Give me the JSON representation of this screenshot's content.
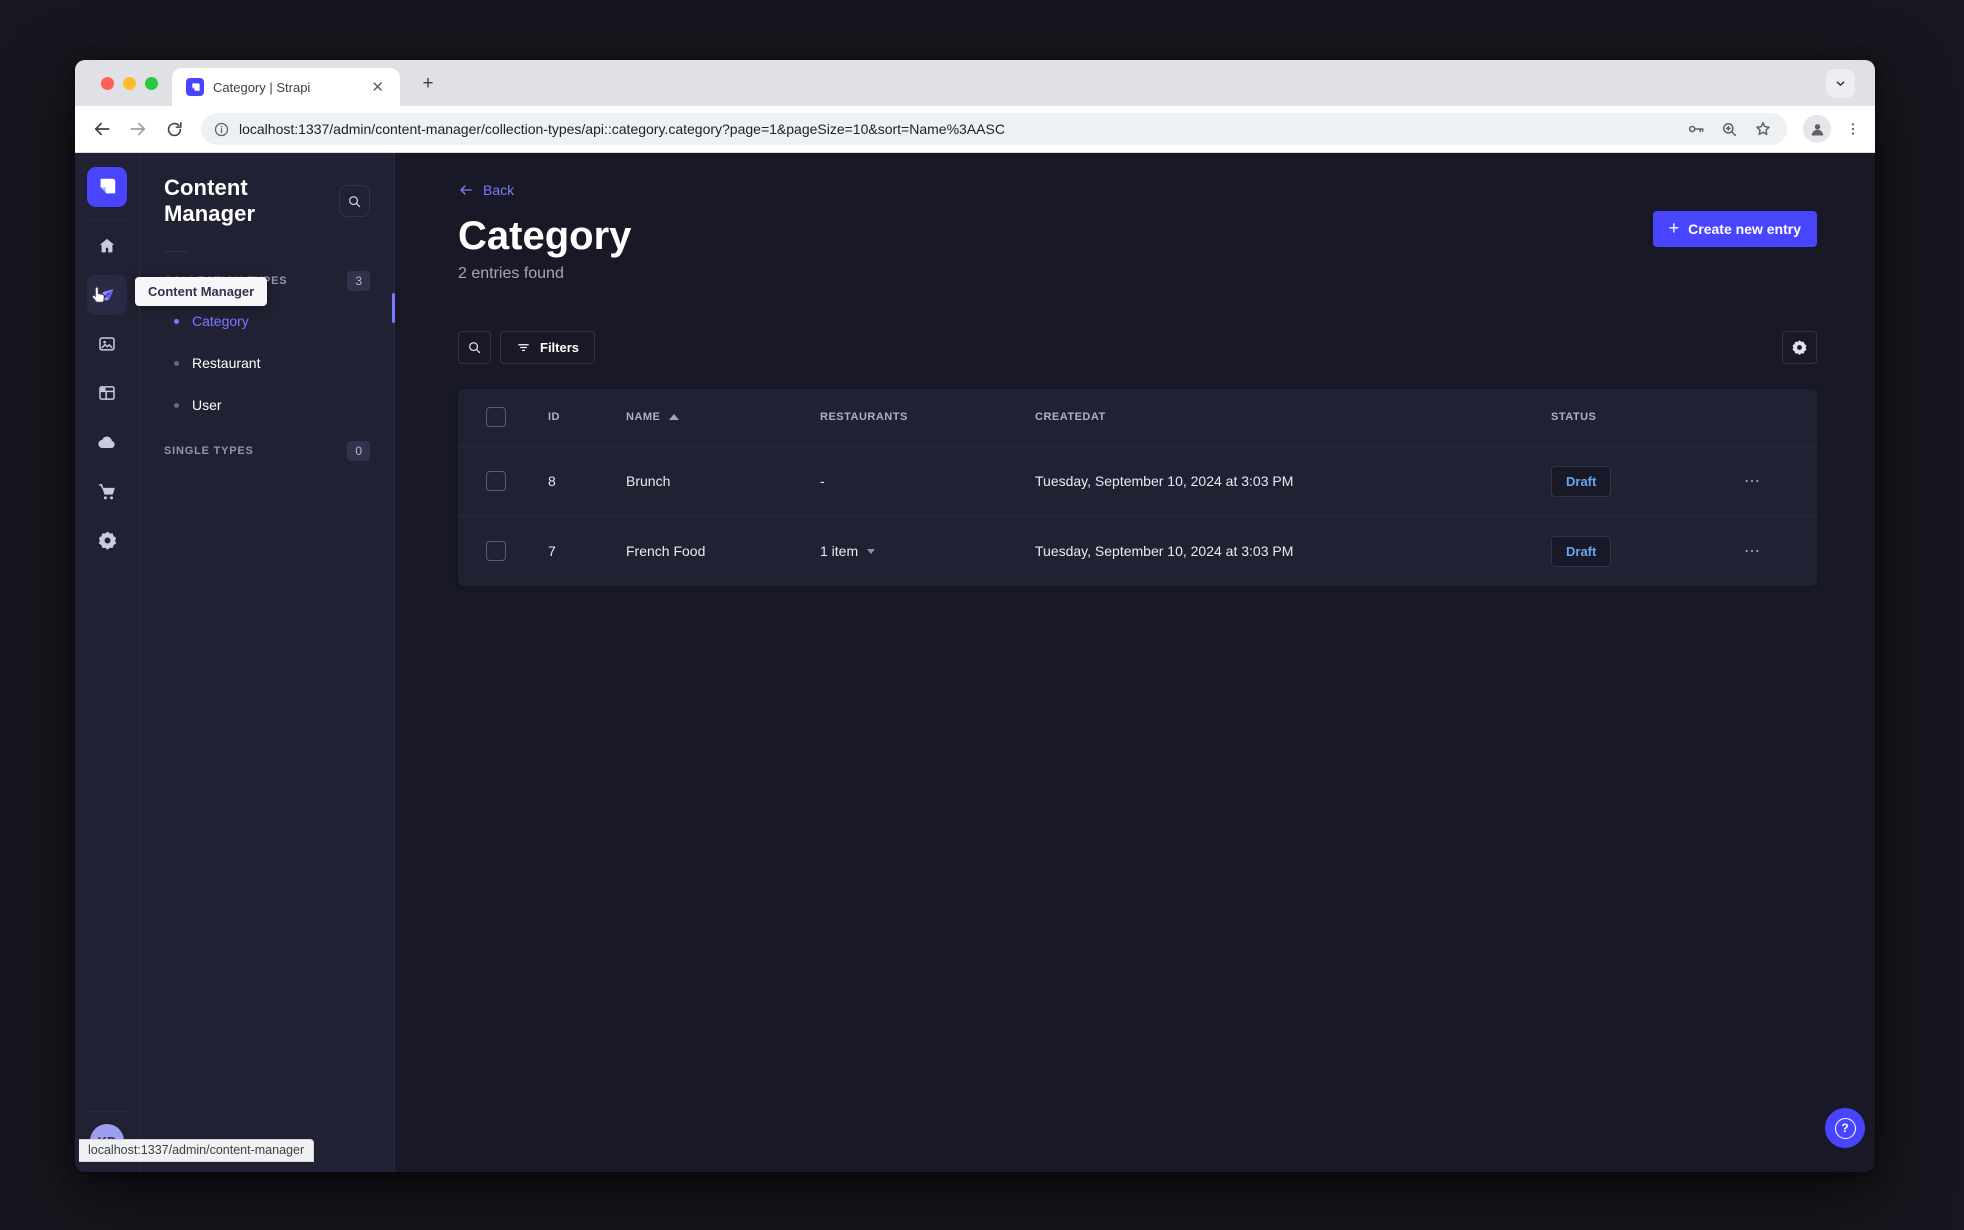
{
  "window": {
    "tab_title": "Category | Strapi",
    "url": "localhost:1337/admin/content-manager/collection-types/api::category.category?page=1&pageSize=10&sort=Name%3AASC"
  },
  "sidebar": {
    "initials": "KD",
    "rail_icons": [
      "strapi-logo",
      "home",
      "content-manager",
      "media-library",
      "content-type-builder",
      "cloud",
      "marketplace",
      "settings"
    ]
  },
  "panel": {
    "title": "Content Manager",
    "sections": {
      "collection": {
        "label": "COLLECTION TYPES",
        "count": "3"
      },
      "single": {
        "label": "SINGLE TYPES",
        "count": "0"
      }
    },
    "items": [
      {
        "label": "Category",
        "active": true
      },
      {
        "label": "Restaurant",
        "active": false
      },
      {
        "label": "User",
        "active": false
      }
    ]
  },
  "tooltip": {
    "text": "Content Manager"
  },
  "statusbar": {
    "text": "localhost:1337/admin/content-manager"
  },
  "main": {
    "back_label": "Back",
    "title": "Category",
    "subtitle": "2 entries found",
    "create_label": "Create new entry",
    "filters_label": "Filters",
    "table": {
      "headers": [
        "ID",
        "NAME",
        "RESTAURANTS",
        "CREATEDAT",
        "STATUS"
      ],
      "sorted_by": "NAME",
      "sort_direction": "ASC",
      "rows": [
        {
          "id": "8",
          "name": "Brunch",
          "restaurants": "-",
          "has_relation_dropdown": false,
          "created": "Tuesday, September 10, 2024 at 3:03 PM",
          "status": "Draft"
        },
        {
          "id": "7",
          "name": "French Food",
          "restaurants": "1 item",
          "has_relation_dropdown": true,
          "created": "Tuesday, September 10, 2024 at 3:03 PM",
          "status": "Draft"
        }
      ]
    }
  },
  "colors": {
    "accent": "#4945ff",
    "link": "#7b79ff",
    "draft_status": "#66a6f5",
    "page_bg": "#181826",
    "surface": "#212134",
    "traffic_close": "#ff5f57",
    "traffic_min": "#febc2e",
    "traffic_max": "#28c840"
  }
}
